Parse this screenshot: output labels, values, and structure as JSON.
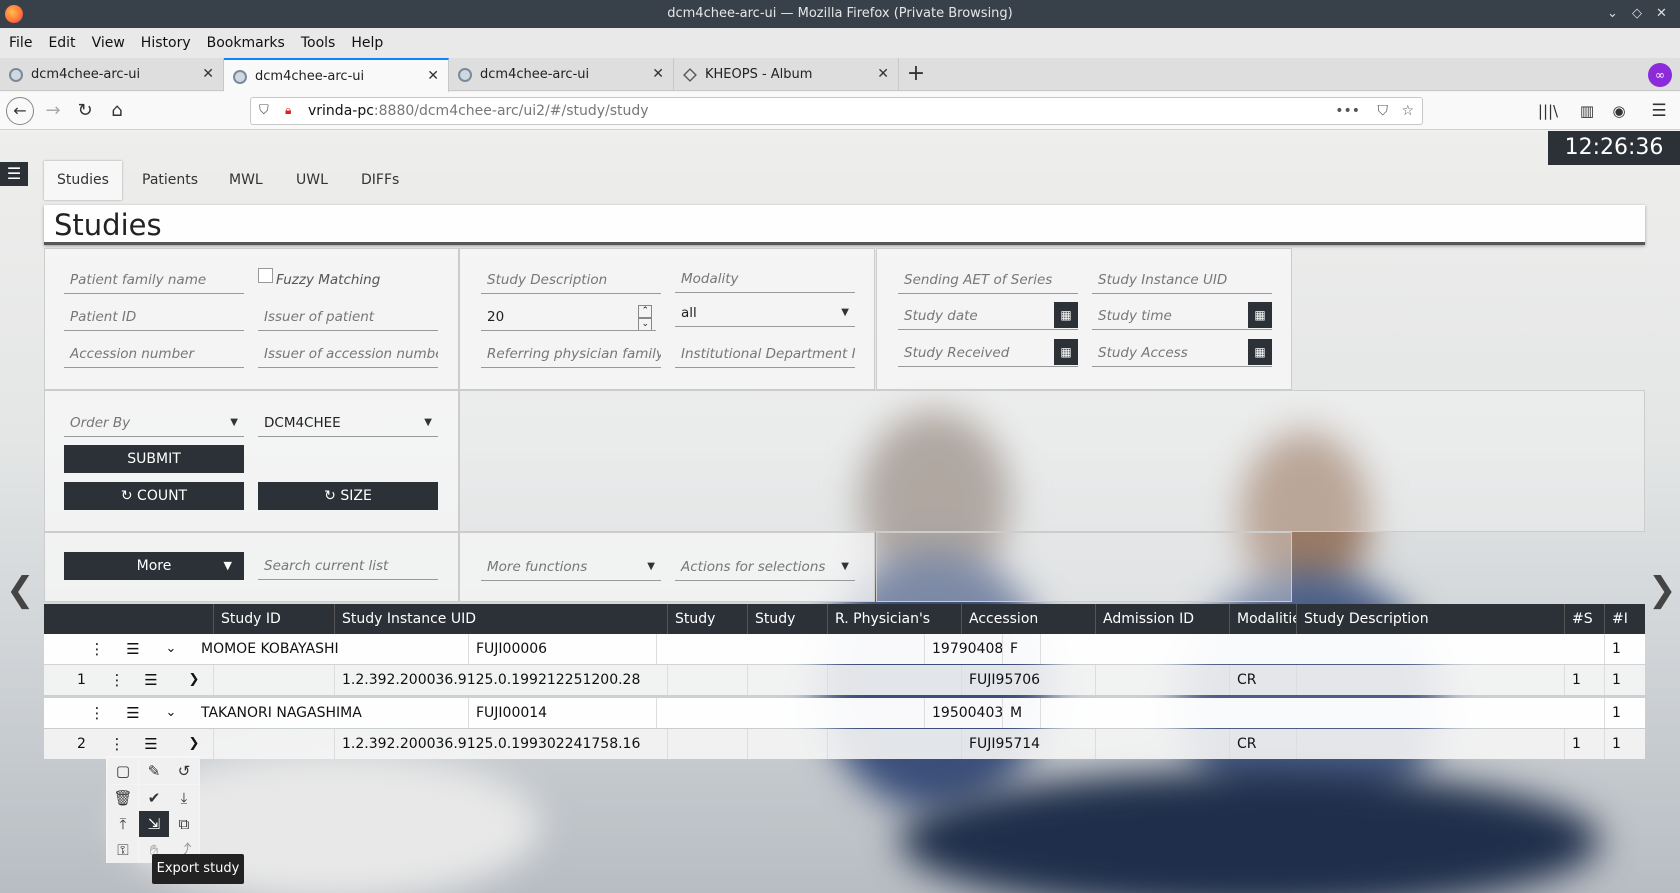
{
  "window": {
    "title": "dcm4chee-arc-ui — Mozilla Firefox (Private Browsing)"
  },
  "menu": [
    "File",
    "Edit",
    "View",
    "History",
    "Bookmarks",
    "Tools",
    "Help"
  ],
  "tabs": [
    {
      "label": "dcm4chee-arc-ui",
      "active": false
    },
    {
      "label": "dcm4chee-arc-ui",
      "active": true
    },
    {
      "label": "dcm4chee-arc-ui",
      "active": false
    },
    {
      "label": "KHEOPS - Album",
      "active": false
    }
  ],
  "url": {
    "host": "vrinda-pc",
    "rest": ":8880/dcm4chee-arc/ui2/#/study/study"
  },
  "clock": "12:26:36",
  "nav_tabs": [
    "Studies",
    "Patients",
    "MWL",
    "UWL",
    "DIFFs"
  ],
  "page_title": "Studies",
  "filters": {
    "patient_family_name": "Patient family name",
    "fuzzy_matching": "Fuzzy Matching",
    "patient_id": "Patient ID",
    "issuer_of_patient": "Issuer of patient",
    "accession_number": "Accession number",
    "issuer_of_accession": "Issuer of accession number",
    "study_description": "Study Description",
    "modality": "Modality",
    "limit": "20",
    "modality_value": "all",
    "referring_physician": "Referring physician family name",
    "institutional_department": "Institutional Department Name",
    "sending_aet": "Sending AET of Series",
    "study_instance_uid": "Study Instance UID",
    "study_date": "Study date",
    "study_time": "Study time",
    "study_received": "Study Received",
    "study_access": "Study Access",
    "order_by": "Order By",
    "aet": "DCM4CHEE",
    "submit": "SUBMIT",
    "count": "COUNT",
    "size": "SIZE",
    "more": "More",
    "search_current_list": "Search current list",
    "more_functions": "More functions",
    "actions_for_selections": "Actions for selections"
  },
  "table": {
    "headers": [
      "Study ID",
      "Study Instance UID",
      "Study",
      "Study",
      "R. Physician's",
      "Accession",
      "Admission ID",
      "Modalities",
      "Study Description",
      "#S",
      "#I"
    ],
    "rows": [
      {
        "kind": "patient",
        "name": "MOMOE KOBAYASHI",
        "pid": "FUJI00006",
        "birth": "19790408",
        "sex": "F",
        "count": "1"
      },
      {
        "kind": "study",
        "index": "1",
        "uid": "1.2.392.200036.9125.0.199212251200.28",
        "accession": "FUJI95706",
        "modality": "CR",
        "series": "1",
        "instances": "1"
      },
      {
        "kind": "patient",
        "name": "TAKANORI NAGASHIMA",
        "pid": "FUJI00014",
        "birth": "19500403",
        "sex": "M",
        "count": "1"
      },
      {
        "kind": "study",
        "index": "2",
        "uid": "1.2.392.200036.9125.0.199302241758.16",
        "accession": "FUJI95714",
        "modality": "CR",
        "series": "1",
        "instances": "1"
      }
    ]
  },
  "tooltip": "Export study"
}
